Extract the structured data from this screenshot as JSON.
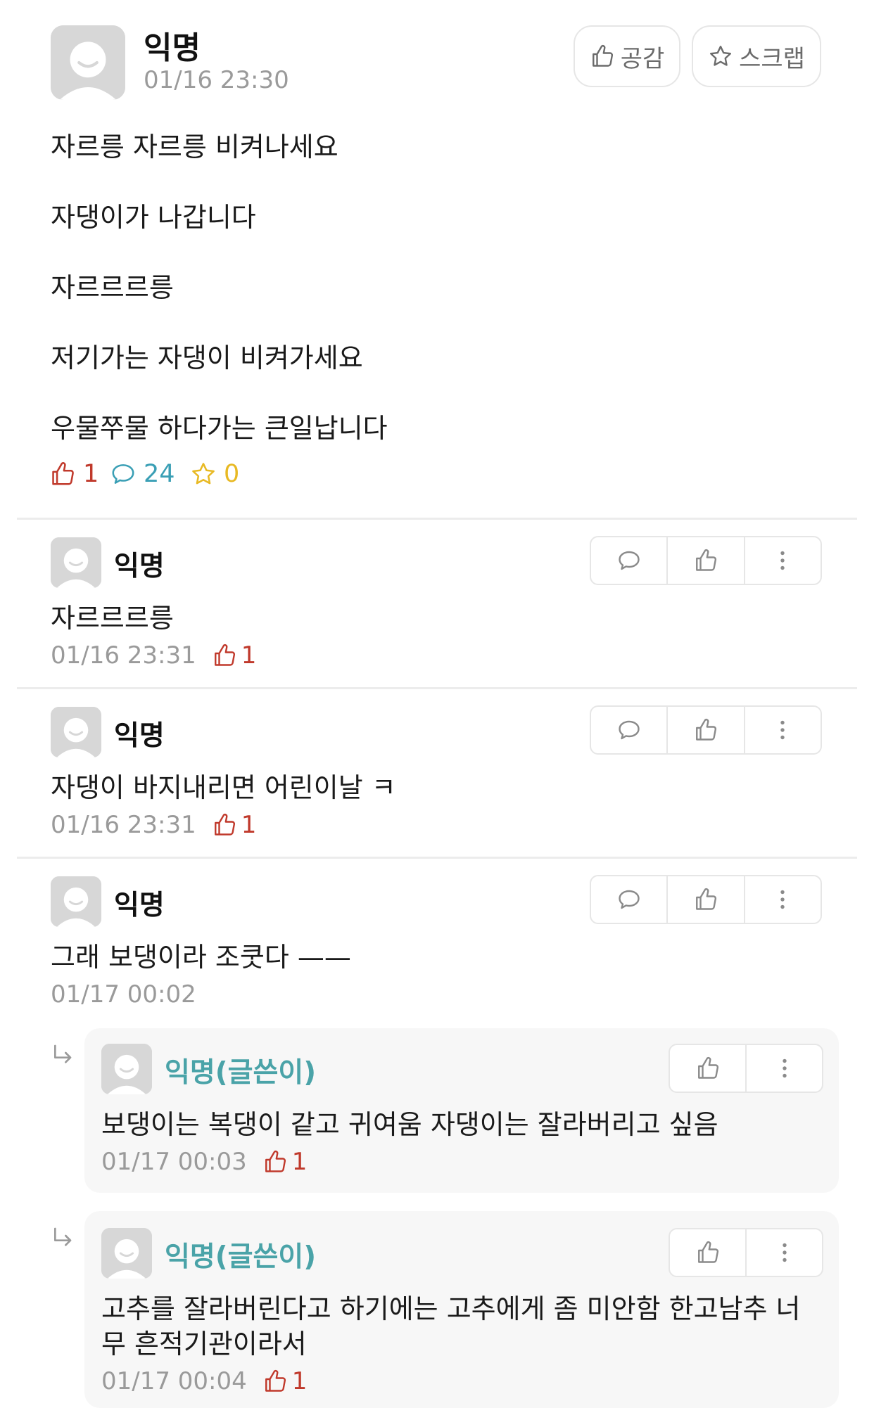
{
  "post": {
    "author": "익명",
    "timestamp": "01/16 23:30",
    "like_button": "공감",
    "scrap_button": "스크랩",
    "lines": [
      "자르릉 자르릉 비켜나세요",
      "자댕이가 나갑니다",
      "자르르르릉",
      "저기가는 자댕이 비켜가세요",
      "우물쭈물 하다가는 큰일납니다"
    ],
    "stats": {
      "likes": "1",
      "comments": "24",
      "scraps": "0"
    }
  },
  "comments": [
    {
      "author": "익명",
      "text": "자르르르릉",
      "timestamp": "01/16 23:31",
      "likes": "1"
    },
    {
      "author": "익명",
      "text": "자댕이 바지내리면 어린이날 ㅋ",
      "timestamp": "01/16 23:31",
      "likes": "1"
    },
    {
      "author": "익명",
      "text": "그래 보댕이라 조쿳다 ——",
      "timestamp": "01/17 00:02",
      "likes": ""
    }
  ],
  "replies": [
    {
      "author": "익명(글쓴이)",
      "text": "보댕이는 복댕이 같고 귀여움 자댕이는 잘라버리고 싶음",
      "timestamp": "01/17 00:03",
      "likes": "1"
    },
    {
      "author": "익명(글쓴이)",
      "text_line1": "고추를 잘라버린다고 하기에는 고추에게 좀 미안함 한고남추 너",
      "text_line2": "무 흔적기관이라서",
      "timestamp": "01/17 00:04",
      "likes": "1"
    }
  ],
  "colors": {
    "like": "#c0392b",
    "comment": "#3a9fb5",
    "scrap": "#e8b923",
    "author_reply": "#4aa3a8"
  },
  "icons": [
    "thumbs-up-icon",
    "star-icon",
    "comment-icon",
    "more-icon",
    "reply-arrow-icon"
  ]
}
